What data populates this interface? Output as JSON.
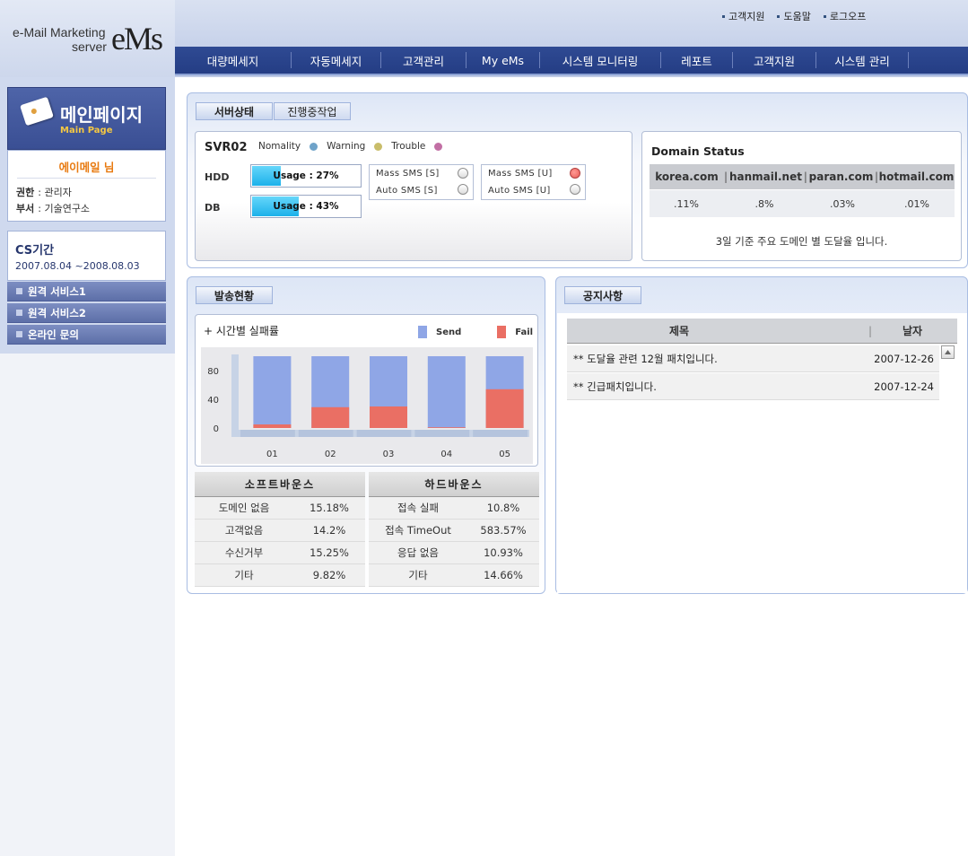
{
  "header": {
    "logo_line1": "e-Mail Marketing",
    "logo_line2": "server",
    "logo_big": "eMs",
    "util_links": [
      "고객지원",
      "도움말",
      "로그오프"
    ],
    "nav": [
      "대량메세지",
      "자동메세지",
      "고객관리",
      "My eMs",
      "시스템 모니터링",
      "레포트",
      "고객지원",
      "시스템 관리"
    ]
  },
  "sidebar": {
    "main_title": "메인페이지",
    "main_sub": "Main Page",
    "user_name": "에이메일 님",
    "role_label": "권한",
    "role_value": "관리자",
    "dept_label": "부서",
    "dept_value": "기술연구소",
    "cs_title": "CS기간",
    "cs_period": "2007.08.04 ~2008.08.03",
    "menu": [
      "원격 서비스1",
      "원격 서비스2",
      "온라인 문의"
    ]
  },
  "server_panel": {
    "tabs": [
      "서버상태",
      "진행중작업"
    ],
    "server_name": "SVR02",
    "legend": [
      {
        "label": "Nomality",
        "color": "#6fa3c9"
      },
      {
        "label": "Warning",
        "color": "#c9bd6a"
      },
      {
        "label": "Trouble",
        "color": "#c26fa4"
      }
    ],
    "hdd_label": "HDD",
    "hdd_text": "Usage : 27%",
    "hdd_pct": 27,
    "db_label": "DB",
    "db_text": "Usage : 43%",
    "db_pct": 43,
    "sms_s": [
      "Mass SMS [S]",
      "Auto SMS [S]"
    ],
    "sms_u": [
      "Mass SMS [U]",
      "Auto SMS [U]"
    ],
    "domain_title": "Domain Status",
    "domains": [
      "korea.com",
      "hanmail.net",
      "paran.com",
      "hotmail.com"
    ],
    "domain_values": [
      ".11%",
      ".8%",
      ".03%",
      ".01%"
    ],
    "domain_note": "3일 기준 주요 도메인 별 도달율 입니다."
  },
  "send_panel": {
    "tab": "발송현황",
    "chart_title": "+ 시간별 실패률",
    "legend_send": "Send",
    "legend_fail": "Fail",
    "color_send": "#8fa6e6",
    "color_fail": "#ea6f64",
    "soft_title": "소프트바운스",
    "soft_rows": [
      {
        "k": "도메인 없음",
        "v": "15.18%"
      },
      {
        "k": "고객없음",
        "v": "14.2%"
      },
      {
        "k": "수신거부",
        "v": "15.25%"
      },
      {
        "k": "기타",
        "v": "9.82%"
      }
    ],
    "hard_title": "하드바운스",
    "hard_rows": [
      {
        "k": "접속 실패",
        "v": "10.8%"
      },
      {
        "k": "접속 TimeOut",
        "v": "583.57%"
      },
      {
        "k": "응답 없음",
        "v": "10.93%"
      },
      {
        "k": "기타",
        "v": "14.66%"
      }
    ]
  },
  "chart_data": {
    "type": "bar",
    "title": "+ 시간별 실패률",
    "categories": [
      "01",
      "02",
      "03",
      "04",
      "05"
    ],
    "series": [
      {
        "name": "Send",
        "values": [
          100,
          100,
          100,
          100,
          100
        ]
      },
      {
        "name": "Fail",
        "values": [
          5,
          29,
          30,
          1,
          54
        ]
      }
    ],
    "y_ticks": [
      0,
      40,
      80
    ],
    "ylim": [
      0,
      100
    ],
    "stacked_overlay": true,
    "legend_position": "top-right"
  },
  "notice_panel": {
    "tab": "공지사항",
    "col_title": "제목",
    "col_date": "날자",
    "rows": [
      {
        "title": "** 도달율 관련 12월 패치입니다.",
        "date": "2007-12-26"
      },
      {
        "title": "** 긴급패치입니다.",
        "date": "2007-12-24"
      }
    ]
  }
}
